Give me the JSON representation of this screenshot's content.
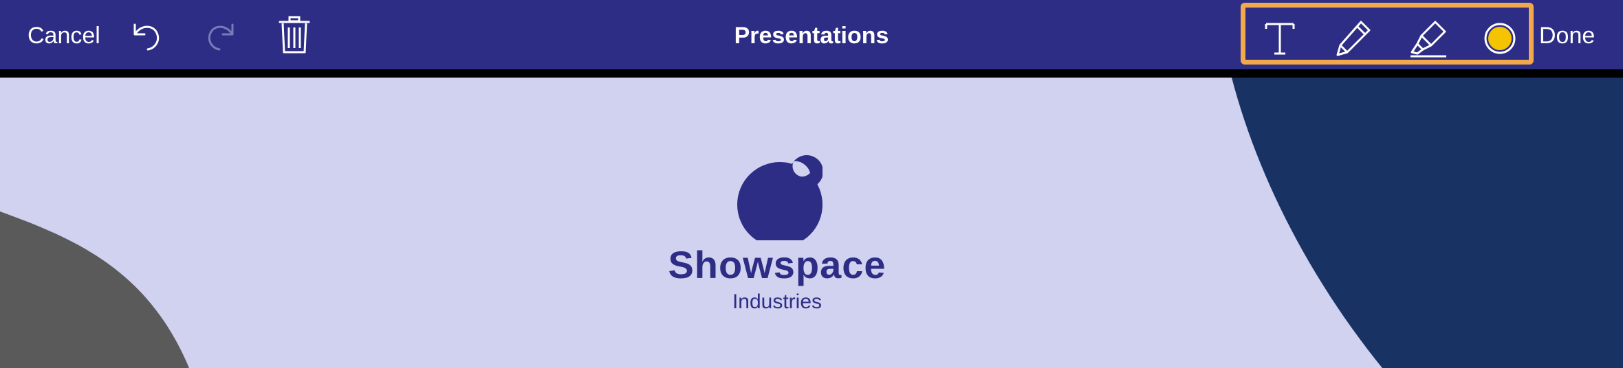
{
  "toolbar": {
    "cancel_label": "Cancel",
    "done_label": "Done",
    "title": "Presentations",
    "icons": {
      "undo": "undo-icon",
      "redo": "redo-icon",
      "trash": "trash-icon",
      "text_tool": "text-tool-icon",
      "pencil_tool": "pencil-icon",
      "highlighter_tool": "highlighter-icon",
      "color_picker": "color-picker-icon"
    },
    "selected_color": "#f5c400",
    "highlight_color": "#f2a94c",
    "background_color": "#2e2d85"
  },
  "slide": {
    "brand_name": "Showspace",
    "brand_sub": "Industries",
    "colors": {
      "background": "#d1d1f0",
      "left_shape": "#5a5a5a",
      "right_shape": "#183263",
      "brand": "#2e2d85"
    }
  }
}
